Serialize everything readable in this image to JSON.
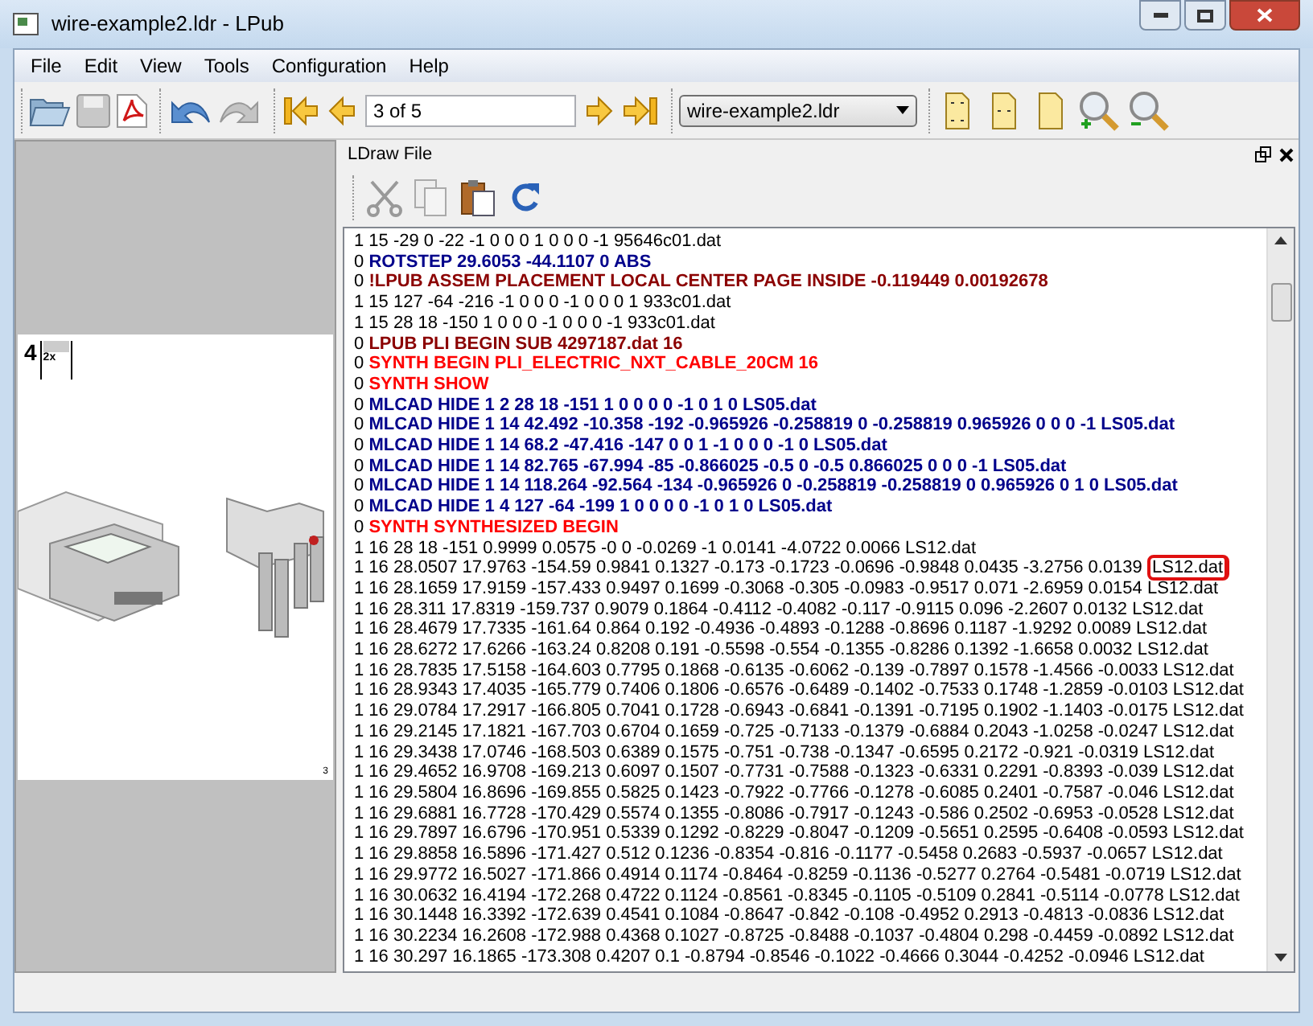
{
  "window": {
    "title": "wire-example2.ldr - LPub"
  },
  "menu": [
    "File",
    "Edit",
    "View",
    "Tools",
    "Configuration",
    "Help"
  ],
  "toolbar": {
    "page_field": {
      "value": "3 of 5"
    },
    "file_dropdown": {
      "value": "wire-example2.ldr"
    }
  },
  "preview": {
    "step_number": "4",
    "part_count": "2x",
    "page_number": "3"
  },
  "dock": {
    "title": "LDraw File"
  },
  "lines": [
    {
      "kind": "plain",
      "text": "1 15 -29 0 -22 -1 0 0 0 1 0 0 0 -1 95646c01.dat"
    },
    {
      "kind": "blue",
      "prefix": "0",
      "text": "ROTSTEP 29.6053 -44.1107 0 ABS"
    },
    {
      "kind": "darkred",
      "prefix": "0",
      "text": "!LPUB ASSEM PLACEMENT LOCAL CENTER PAGE INSIDE -0.119449 0.00192678"
    },
    {
      "kind": "plain",
      "text": "1 15 127 -64 -216 -1 0 0 0 -1 0 0 0 1 933c01.dat"
    },
    {
      "kind": "plain",
      "text": "1 15 28 18 -150 1 0 0 0 -1 0 0 0 -1 933c01.dat"
    },
    {
      "kind": "darkred",
      "prefix": "0",
      "text": "LPUB PLI BEGIN SUB 4297187.dat 16"
    },
    {
      "kind": "red",
      "prefix": "0",
      "text": "SYNTH BEGIN PLI_ELECTRIC_NXT_CABLE_20CM 16"
    },
    {
      "kind": "red",
      "prefix": "0",
      "text": "SYNTH SHOW"
    },
    {
      "kind": "blue",
      "prefix": "0",
      "text": "MLCAD HIDE 1 2 28 18 -151 1 0 0 0 0 -1 0 1 0 LS05.dat"
    },
    {
      "kind": "blue",
      "prefix": "0",
      "text": "MLCAD HIDE 1 14 42.492 -10.358 -192 -0.965926 -0.258819 0 -0.258819 0.965926 0 0 0 -1 LS05.dat"
    },
    {
      "kind": "blue",
      "prefix": "0",
      "text": "MLCAD HIDE 1 14 68.2 -47.416 -147 0 0 1 -1 0 0 0 -1 0 LS05.dat"
    },
    {
      "kind": "blue",
      "prefix": "0",
      "text": "MLCAD HIDE 1 14 82.765 -67.994 -85 -0.866025 -0.5 0 -0.5 0.866025 0 0 0 -1 LS05.dat"
    },
    {
      "kind": "blue",
      "prefix": "0",
      "text": "MLCAD HIDE 1 14 118.264 -92.564 -134 -0.965926 0 -0.258819 -0.258819 0 0.965926 0 1 0 LS05.dat"
    },
    {
      "kind": "blue",
      "prefix": "0",
      "text": "MLCAD HIDE 1 4 127 -64 -199 1 0 0 0 0 -1 0 1 0 LS05.dat"
    },
    {
      "kind": "red",
      "prefix": "0",
      "text": "SYNTH SYNTHESIZED BEGIN"
    },
    {
      "kind": "plain",
      "text": "1 16 28 18 -151 0.9999 0.0575 -0 0 -0.0269 -1 0.0141 -4.0722 0.0066 LS12.dat"
    },
    {
      "kind": "plain",
      "text": "1 16 28.0507 17.9763 -154.59 0.9841 0.1327 -0.173 -0.1723 -0.0696 -0.9848 0.0435 -3.2756 0.0139",
      "highlight": "LS12.dat"
    },
    {
      "kind": "plain",
      "text": "1 16 28.1659 17.9159 -157.433 0.9497 0.1699 -0.3068 -0.305 -0.0983 -0.9517 0.071 -2.6959 0.0154 LS12.dat"
    },
    {
      "kind": "plain",
      "text": "1 16 28.311 17.8319 -159.737 0.9079 0.1864 -0.4112 -0.4082 -0.117 -0.9115 0.096 -2.2607 0.0132 LS12.dat"
    },
    {
      "kind": "plain",
      "text": "1 16 28.4679 17.7335 -161.64 0.864 0.192 -0.4936 -0.4893 -0.1288 -0.8696 0.1187 -1.9292 0.0089 LS12.dat"
    },
    {
      "kind": "plain",
      "text": "1 16 28.6272 17.6266 -163.24 0.8208 0.191 -0.5598 -0.554 -0.1355 -0.8286 0.1392 -1.6658 0.0032 LS12.dat"
    },
    {
      "kind": "plain",
      "text": "1 16 28.7835 17.5158 -164.603 0.7795 0.1868 -0.6135 -0.6062 -0.139 -0.7897 0.1578 -1.4566 -0.0033 LS12.dat"
    },
    {
      "kind": "plain",
      "text": "1 16 28.9343 17.4035 -165.779 0.7406 0.1806 -0.6576 -0.6489 -0.1402 -0.7533 0.1748 -1.2859 -0.0103 LS12.dat"
    },
    {
      "kind": "plain",
      "text": "1 16 29.0784 17.2917 -166.805 0.7041 0.1728 -0.6943 -0.6841 -0.1391 -0.7195 0.1902 -1.1403 -0.0175 LS12.dat"
    },
    {
      "kind": "plain",
      "text": "1 16 29.2145 17.1821 -167.703 0.6704 0.1659 -0.725 -0.7133 -0.1379 -0.6884 0.2043 -1.0258 -0.0247 LS12.dat"
    },
    {
      "kind": "plain",
      "text": "1 16 29.3438 17.0746 -168.503 0.6389 0.1575 -0.751 -0.738 -0.1347 -0.6595 0.2172 -0.921 -0.0319 LS12.dat"
    },
    {
      "kind": "plain",
      "text": "1 16 29.4652 16.9708 -169.213 0.6097 0.1507 -0.7731 -0.7588 -0.1323 -0.6331 0.2291 -0.8393 -0.039 LS12.dat"
    },
    {
      "kind": "plain",
      "text": "1 16 29.5804 16.8696 -169.855 0.5825 0.1423 -0.7922 -0.7766 -0.1278 -0.6085 0.2401 -0.7587 -0.046 LS12.dat"
    },
    {
      "kind": "plain",
      "text": "1 16 29.6881 16.7728 -170.429 0.5574 0.1355 -0.8086 -0.7917 -0.1243 -0.586 0.2502 -0.6953 -0.0528 LS12.dat"
    },
    {
      "kind": "plain",
      "text": "1 16 29.7897 16.6796 -170.951 0.5339 0.1292 -0.8229 -0.8047 -0.1209 -0.5651 0.2595 -0.6408 -0.0593 LS12.dat"
    },
    {
      "kind": "plain",
      "text": "1 16 29.8858 16.5896 -171.427 0.512 0.1236 -0.8354 -0.816 -0.1177 -0.5458 0.2683 -0.5937 -0.0657 LS12.dat"
    },
    {
      "kind": "plain",
      "text": "1 16 29.9772 16.5027 -171.866 0.4914 0.1174 -0.8464 -0.8259 -0.1136 -0.5277 0.2764 -0.5481 -0.0719 LS12.dat"
    },
    {
      "kind": "plain",
      "text": "1 16 30.0632 16.4194 -172.268 0.4722 0.1124 -0.8561 -0.8345 -0.1105 -0.5109 0.2841 -0.5114 -0.0778 LS12.dat"
    },
    {
      "kind": "plain",
      "text": "1 16 30.1448 16.3392 -172.639 0.4541 0.1084 -0.8647 -0.842 -0.108 -0.4952 0.2913 -0.4813 -0.0836 LS12.dat"
    },
    {
      "kind": "plain",
      "text": "1 16 30.2234 16.2608 -172.988 0.4368 0.1027 -0.8725 -0.8488 -0.1037 -0.4804 0.298 -0.4459 -0.0892 LS12.dat"
    },
    {
      "kind": "plain",
      "text": "1 16 30.297 16.1865 -173.308 0.4207 0.1 -0.8794 -0.8546 -0.1022 -0.4666 0.3044 -0.4252 -0.0946 LS12.dat"
    }
  ]
}
